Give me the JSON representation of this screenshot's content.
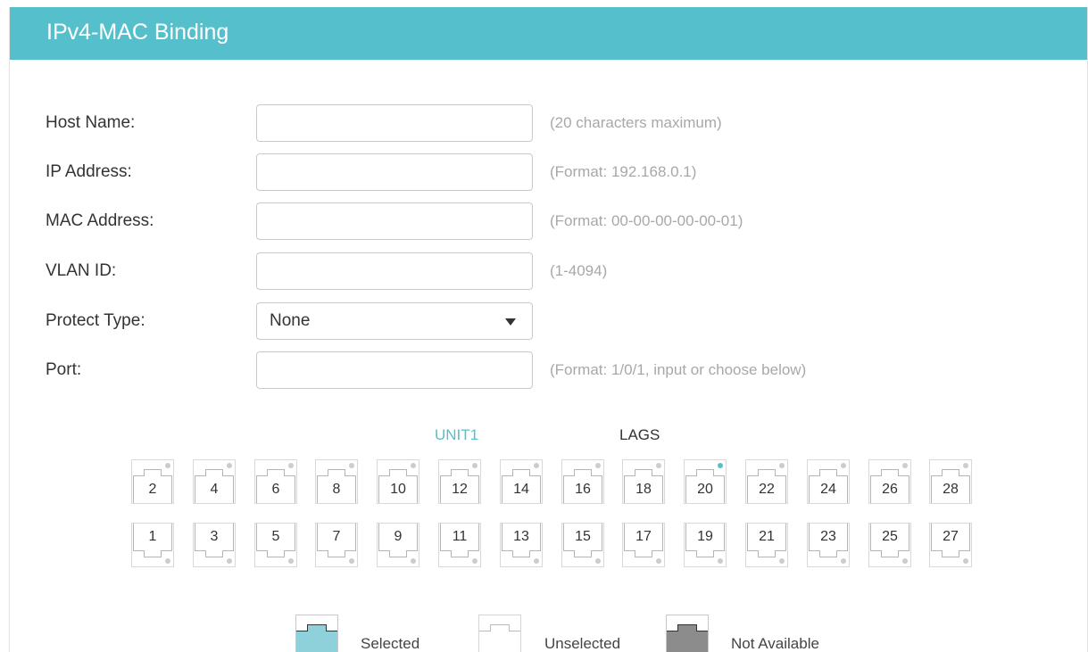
{
  "header": {
    "title": "IPv4-MAC Binding"
  },
  "form": {
    "host_name": {
      "label": "Host Name:",
      "value": "",
      "hint": "(20 characters maximum)"
    },
    "ip_address": {
      "label": "IP Address:",
      "value": "",
      "hint": "(Format: 192.168.0.1)"
    },
    "mac_address": {
      "label": "MAC Address:",
      "value": "",
      "hint": "(Format: 00-00-00-00-00-01)"
    },
    "vlan_id": {
      "label": "VLAN ID:",
      "value": "",
      "hint": "(1-4094)"
    },
    "protect_type": {
      "label": "Protect Type:",
      "selected": "None"
    },
    "port": {
      "label": "Port:",
      "value": "",
      "hint": "(Format: 1/0/1, input or choose below)"
    }
  },
  "unit_tabs": {
    "unit1": "UNIT1",
    "lags": "LAGS"
  },
  "ports": {
    "top": [
      "2",
      "4",
      "6",
      "8",
      "10",
      "12",
      "14",
      "16",
      "18",
      "20",
      "22",
      "24",
      "26",
      "28"
    ],
    "bottom": [
      "1",
      "3",
      "5",
      "7",
      "9",
      "11",
      "13",
      "15",
      "17",
      "19",
      "21",
      "23",
      "25",
      "27"
    ],
    "link_up": [
      "20"
    ]
  },
  "legend": {
    "selected": "Selected",
    "unselected": "Unselected",
    "not_available": "Not Available"
  },
  "colors": {
    "accent": "#55c0cc",
    "port_border": "#b5b5b5",
    "dot_idle": "#cccccc",
    "dot_active": "#55c0cc",
    "not_available": "#8c8c8c"
  }
}
